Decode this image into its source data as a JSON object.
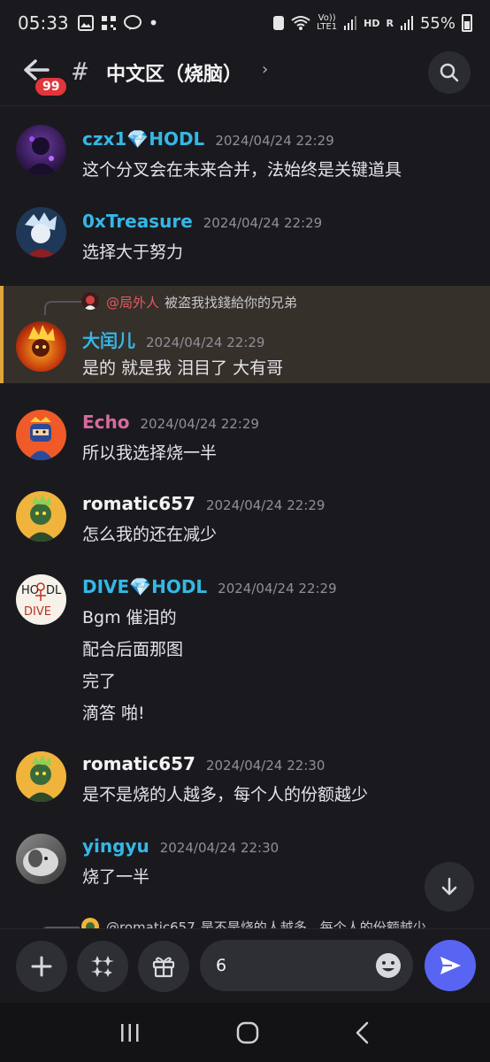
{
  "status_bar": {
    "time": "05:33",
    "battery": "55%",
    "network_small_top": "Vo))",
    "network_small_bottom": "LTE1",
    "hd": "HD",
    "r_label": "R"
  },
  "header": {
    "unread_badge": "99",
    "hash": "#",
    "channel_name": "中文区（烧脑）",
    "chevron": "›"
  },
  "messages": [
    {
      "user": "czx1💎HODL",
      "color": "#35b7e6",
      "time": "2024/04/24 22:29",
      "lines": [
        "这个分叉会在未来合并，法始终是关键道具"
      ]
    },
    {
      "user": "0xTreasure",
      "color": "#35b7e6",
      "time": "2024/04/24 22:29",
      "lines": [
        "选择大于努力"
      ]
    },
    {
      "user": "大闰儿",
      "color": "#35b7e6",
      "time": "2024/04/24 22:29",
      "lines": [
        "是的 就是我 泪目了 大有哥"
      ],
      "reply": {
        "mention": "@局外人",
        "text": "被盗我找錢給你的兄弟"
      }
    },
    {
      "user": "Echo",
      "color": "#d66a9b",
      "time": "2024/04/24 22:29",
      "lines": [
        "所以我选择烧一半"
      ]
    },
    {
      "user": "romatic657",
      "color": "#f2f3f5",
      "time": "2024/04/24 22:29",
      "lines": [
        "怎么我的还在减少"
      ]
    },
    {
      "user": "DIVE💎HODL",
      "color": "#35b7e6",
      "time": "2024/04/24 22:29",
      "lines": [
        "Bgm 催泪的",
        "配合后面那图",
        "完了",
        "滴答 啪!"
      ]
    },
    {
      "user": "romatic657",
      "color": "#f2f3f5",
      "time": "2024/04/24 22:30",
      "lines": [
        "是不是烧的人越多，每个人的份额越少"
      ]
    },
    {
      "user": "yingyu",
      "color": "#35b7e6",
      "time": "2024/04/24 22:30",
      "lines": [
        "烧了一半"
      ]
    }
  ],
  "partial_reply": {
    "mention": "@romatic657",
    "text": "是不是烧的人越多，每个人的份额越少"
  },
  "composer": {
    "input_value": "6"
  },
  "icons": {
    "back": "arrow-left-icon",
    "search": "search-icon",
    "plus": "plus-icon",
    "apps": "apps-icon",
    "gift": "gift-icon",
    "emoji": "emoji-icon",
    "send": "send-icon",
    "scroll_down": "arrow-down-icon"
  }
}
